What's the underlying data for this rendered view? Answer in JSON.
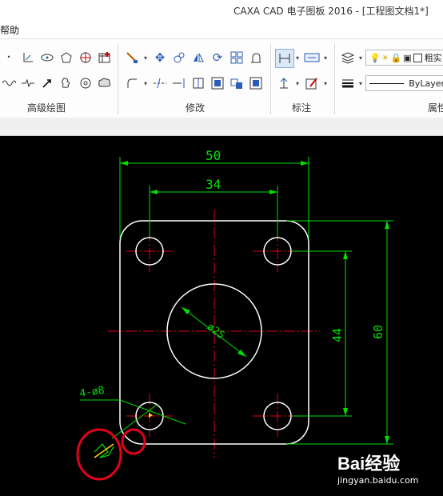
{
  "window": {
    "title": "CAXA CAD 电子图板 2016 - [工程图文档1*]"
  },
  "menu": {
    "help_label": "帮助"
  },
  "ribbon": {
    "groups": [
      {
        "label": "高级绘图"
      },
      {
        "label": "修改"
      },
      {
        "label": "标注"
      },
      {
        "label": "属性"
      }
    ],
    "linetype_value": "ByLayer",
    "layer_value": "粗实"
  },
  "drawing": {
    "dim_overall_width": "50",
    "dim_hole_spacing_x": "34",
    "dim_center_circle": "ø25",
    "dim_hole_spacing_y": "44",
    "dim_overall_height": "60",
    "dim_holes": "4-ø8",
    "marker_color": "#e0001a",
    "geometry_color": "#ffffff",
    "centerline_color": "#e0001a",
    "dimension_color": "#00e000"
  },
  "watermark": {
    "brand_text": "Bai经验",
    "url_text": "jingyan.baidu.com"
  }
}
